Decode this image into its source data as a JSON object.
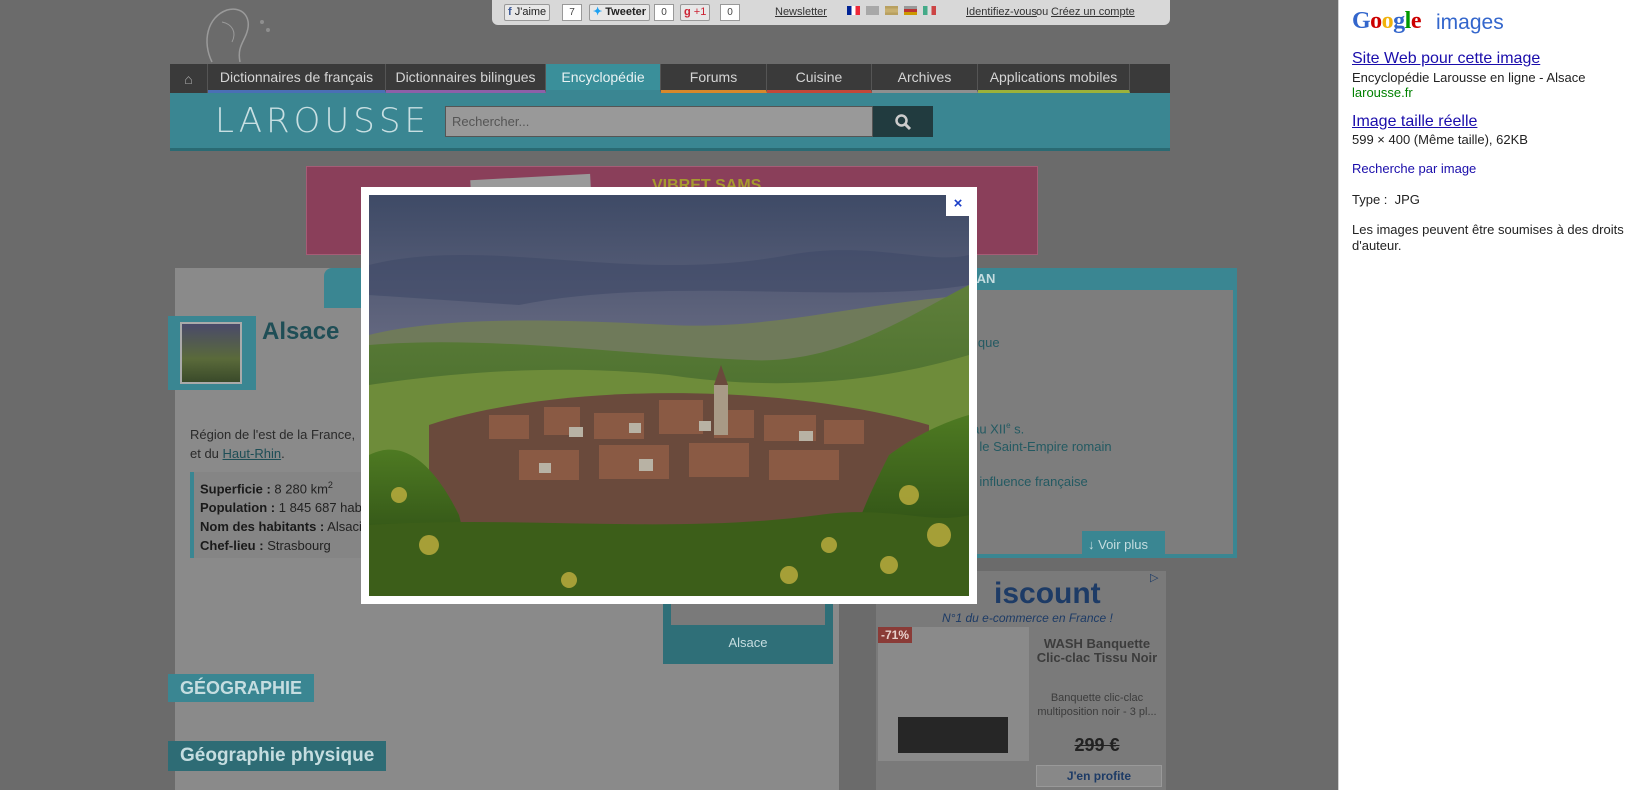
{
  "topbar": {
    "like_label": "J'aime",
    "like_count": "7",
    "tweet_label": "Tweeter",
    "tweet_count": "0",
    "plusone_label": "+1",
    "plusone_count": "0",
    "newsletter": "Newsletter",
    "login": "Identifiez-vous",
    "or": "ou",
    "register": "Créez un compte"
  },
  "nav": {
    "tabs": [
      {
        "label": "Dictionnaires de français",
        "color": "#4a6fb5"
      },
      {
        "label": "Dictionnaires bilingues",
        "color": "#8e5fa8"
      },
      {
        "label": "Encyclopédie",
        "color": "#3a8692"
      },
      {
        "label": "Forums",
        "color": "#d7882b"
      },
      {
        "label": "Cuisine",
        "color": "#c2483a"
      },
      {
        "label": "Archives",
        "color": "#8f8f8f"
      },
      {
        "label": "Applications mobiles",
        "color": "#9cb23a"
      }
    ]
  },
  "brand": {
    "logo": "LAROUSSE",
    "search_placeholder": "Rechercher..."
  },
  "banner": {
    "text": "VIBRET SAMS"
  },
  "article": {
    "title": "Alsace",
    "intro_1": "Région de l'est de la France,",
    "intro_2": "et du",
    "intro_link": "Haut-Rhin",
    "intro_end": ".",
    "facts": {
      "area_label": "Superficie :",
      "area_value": "8 280 km",
      "area_sup": "2",
      "pop_label": "Population :",
      "pop_value": "1 845 687 hab.",
      "inhab_label": "Nom des habitants :",
      "inhab_value": "Alsaci",
      "capital_label": "Chef-lieu :",
      "capital_value": "Strasbourg"
    },
    "geo_heading": "GÉOGRAPHIE",
    "geo_sub": "Géographie physique",
    "map_label": "Alsace"
  },
  "plan": {
    "heading": "PLAN",
    "items": [
      "ysique",
      "s au XII",
      "ns le Saint-Empire romain",
      "us influence française"
    ],
    "item2_sup": "e",
    "item2_end": " s.",
    "more": "Voir plus"
  },
  "ad": {
    "brand": "iscount",
    "tagline": "N°1 du e-commerce en France !",
    "discount": "-71%",
    "product": "WASH Banquette Clic-clac Tissu Noir",
    "desc": "Banquette clic-clac multiposition noir - 3 pl...",
    "price": "299 €",
    "cta": "J'en profite"
  },
  "lightbox": {
    "close": "×"
  },
  "google": {
    "logo_letters": [
      {
        "ch": "G",
        "color": "#3366cc"
      },
      {
        "ch": "o",
        "color": "#cc0000"
      },
      {
        "ch": "o",
        "color": "#f1b20c"
      },
      {
        "ch": "g",
        "color": "#3366cc"
      },
      {
        "ch": "l",
        "color": "#009900"
      },
      {
        "ch": "e",
        "color": "#cc0000"
      }
    ],
    "images": "images",
    "site_link": "Site Web pour cette image",
    "site_title": "Encyclopédie Larousse en ligne - Alsace",
    "site_domain": "larousse.fr",
    "full_link": "Image taille réelle",
    "full_info": "599 × 400 (Même taille), 62KB",
    "search_by_image": "Recherche par image",
    "type": "Type :  JPG",
    "copyright": "Les images peuvent être soumises à des droits d'auteur."
  }
}
